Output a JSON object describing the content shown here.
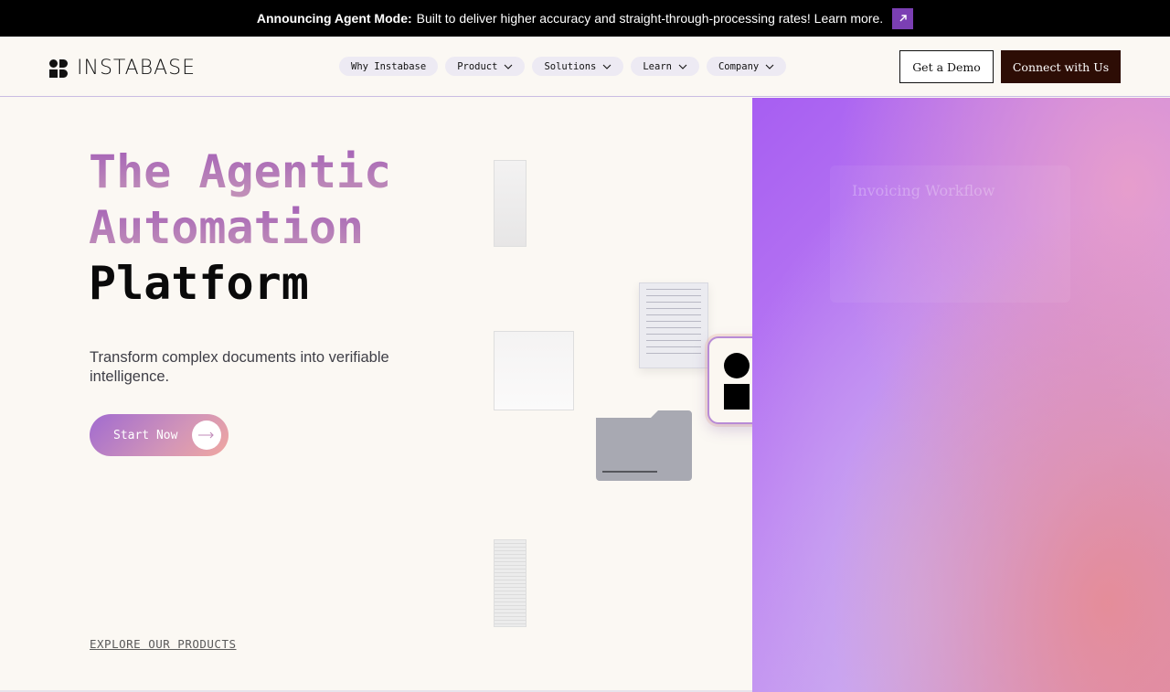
{
  "announcement": {
    "bold": "Announcing Agent Mode:",
    "text": "Built to deliver higher accuracy and straight-through-processing rates! Learn more.",
    "arrow_icon": "arrow-up-right-icon",
    "accent": "#7b3fb3"
  },
  "nav": {
    "logo_text": "INSTABASE",
    "items": [
      {
        "label": "Why Instabase",
        "dropdown": false
      },
      {
        "label": "Product",
        "dropdown": true
      },
      {
        "label": "Solutions",
        "dropdown": true
      },
      {
        "label": "Learn",
        "dropdown": true
      },
      {
        "label": "Company",
        "dropdown": true
      }
    ],
    "demo_label": "Get a Demo",
    "connect_label": "Connect with Us"
  },
  "hero": {
    "title_line1": "The Agentic",
    "title_line2": "Automation",
    "title_line3": "Platform",
    "subtitle": "Transform complex documents into verifiable intelligence.",
    "cta_label": "Start Now",
    "explore_label": "EXPLORE OUR PRODUCTS"
  },
  "panel": {
    "card_title": "Invoicing Workflow"
  },
  "colors": {
    "background": "#fbf8f3",
    "connect_button": "#2d0d05",
    "title_gradient_start": "#a35fb7",
    "panel_gradient_start": "#a75ef2",
    "panel_gradient_end": "#d98fb8"
  }
}
